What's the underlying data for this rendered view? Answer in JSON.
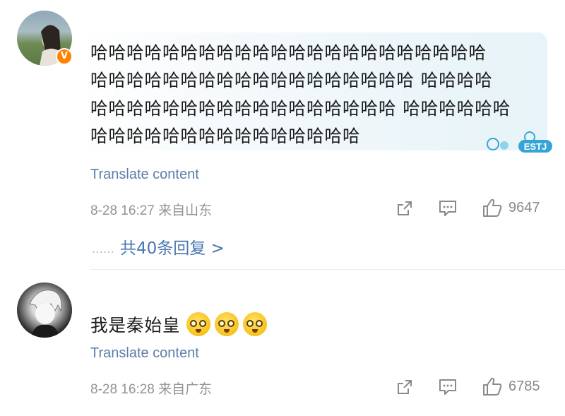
{
  "comments": [
    {
      "has_verified_badge": true,
      "badge_text": "V",
      "text_lines": [
        "哈哈哈哈哈哈哈哈哈哈哈哈哈哈哈哈哈哈哈哈哈哈",
        "哈哈哈哈哈哈哈哈哈哈哈哈哈哈哈哈哈哈 哈哈哈哈",
        "哈哈哈哈哈哈哈哈哈哈哈哈哈哈哈哈哈 哈哈哈哈哈哈",
        "哈哈哈哈哈哈哈哈哈哈哈哈哈哈哈"
      ],
      "sticker_text": "ESTJ",
      "translate_label": "Translate content",
      "timestamp": "8-28 16:27",
      "location": "来自山东",
      "likes": "9647",
      "replies_dots": "……",
      "replies_label": "共40条回复 >"
    },
    {
      "text": "我是秦始皇",
      "emoji_count": 3,
      "translate_label": "Translate content",
      "timestamp": "8-28 16:28",
      "location": "来自广东",
      "likes": "6785"
    }
  ],
  "icons": {
    "share": "share-icon",
    "comment": "comment-icon",
    "like": "thumbs-up-icon"
  },
  "colors": {
    "link": "#5b7fa8",
    "replies": "#4a76b0",
    "meta": "#939393",
    "verified_badge": "#ff8200"
  }
}
